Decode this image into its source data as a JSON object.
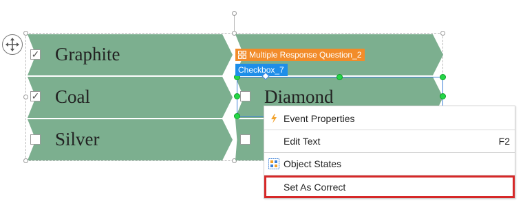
{
  "options": [
    {
      "label": "Graphite",
      "checked": true
    },
    {
      "label": "Coal",
      "checked": true
    },
    {
      "label": "Silver",
      "checked": false
    },
    {
      "label": "Diamond",
      "checked": false
    }
  ],
  "tags": {
    "question": "Multiple Response Question_2",
    "checkbox": "Checkbox_7"
  },
  "context_menu": {
    "items": [
      {
        "label": "Event Properties",
        "icon": "lightning-icon",
        "shortcut": ""
      },
      {
        "label": "Edit Text",
        "icon": "",
        "shortcut": "F2"
      },
      {
        "label": "Object States",
        "icon": "object-states-icon",
        "shortcut": ""
      },
      {
        "label": "Set As Correct",
        "icon": "",
        "shortcut": "",
        "highlighted": true
      }
    ]
  },
  "colors": {
    "option_fill": "#7caf8f",
    "tag_orange": "#f28c2a",
    "tag_blue": "#1e8ee9",
    "handle_green": "#24d646",
    "highlight_red": "#d62828"
  }
}
